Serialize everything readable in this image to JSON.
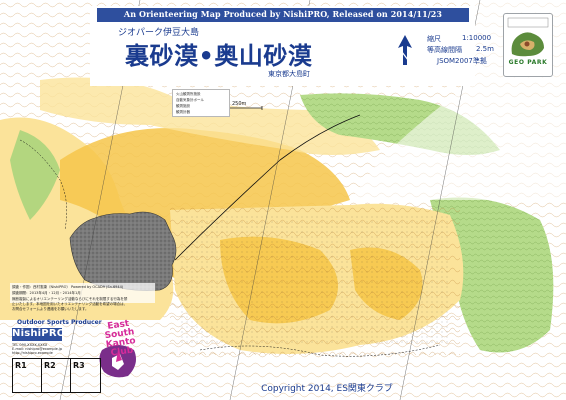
{
  "banner": "An Orienteering Map Produced by NishiPRO, Released on 2014/11/23",
  "title_block": {
    "subtitle": "ジオパーク伊豆大島",
    "main_title": "裏砂漠•奥山砂漠",
    "location": "東京都大島町"
  },
  "map_specs": {
    "scale_label": "縮尺",
    "scale_value": "1:10000",
    "contour_label": "等高線間隔",
    "contour_value": "2.5m",
    "standard": "JSOM2007準拠"
  },
  "geopark_logo": {
    "text": "GEO PARK"
  },
  "legend": {
    "items": [
      "火山観測所施設",
      "自動気象計ポール",
      "観測施設",
      "観測計器"
    ]
  },
  "scale_bar": {
    "label": "250m"
  },
  "map_info": {
    "lines": [
      "調査・作図：西村憲康（NishiPRO） Powered by OCAD9 (Sn.6944)",
      "調査期間：2013年4月・12月・2014年1月"
    ],
    "footnote_lines": [
      "無断複製によるオリエンテーリング活動ならびにそれを制限する行為を禁",
      "止いたします。本地図を用いたオリエンテーリング活動を希望の場合は、",
      "お問合せフォームより連絡をお願いいたします。"
    ]
  },
  "producer": {
    "label": "Outdoor Sports Producer",
    "name": "NishiPRO",
    "contact_lines": [
      "TEL 090-XXXX-XXXX",
      "E-mail: nishipro@example.jp",
      "http://nishipro.example"
    ]
  },
  "club": {
    "name": "East South Kanto Club"
  },
  "runner_boxes": [
    "R1",
    "R2",
    "R3"
  ],
  "copyright": "Copyright 2014, ES関東クラブ",
  "colors": {
    "banner_blue": "#2e4f9e",
    "title_blue": "#1a3b8f",
    "open_land_yellow": "#f6c64a",
    "rough_open_yellow": "#fbe39a",
    "vegetation_green": "#a6d37a",
    "lava_gray": "#7a7a7a",
    "contour_brown": "#c78a3e",
    "background_white": "#ffffff",
    "club_pink": "#d62b9a"
  },
  "icons": [
    "north-arrow-icon",
    "geopark-logo-icon",
    "club-logo-icon",
    "scale-bar-icon"
  ]
}
